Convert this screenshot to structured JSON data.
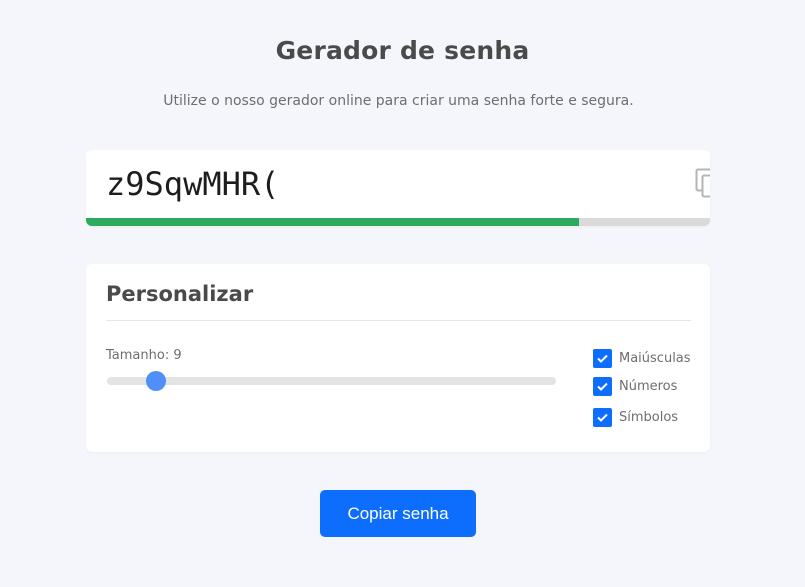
{
  "header": {
    "title": "Gerador de senha",
    "subtitle": "Utilize o nosso gerador online para criar uma senha forte e segura."
  },
  "password": {
    "value": "z9SqwMHR(",
    "strength_fraction": 0.79,
    "strength_color": "#2eaa5f",
    "copy_icon": "copy-icon",
    "refresh_icon": "refresh-icon"
  },
  "customize": {
    "title": "Personalizar",
    "length_label": "Tamanho: 9",
    "length_value": 9,
    "length_min": 4,
    "length_max": 50,
    "options": [
      {
        "label": "Maiúsculas",
        "checked": true
      },
      {
        "label": "Números",
        "checked": true
      },
      {
        "label": "Símbolos",
        "checked": true
      }
    ]
  },
  "actions": {
    "copy_label": "Copiar senha"
  },
  "colors": {
    "accent": "#0d6efd",
    "slider_thumb": "#4f8ff7",
    "background": "#f4f6fb"
  }
}
